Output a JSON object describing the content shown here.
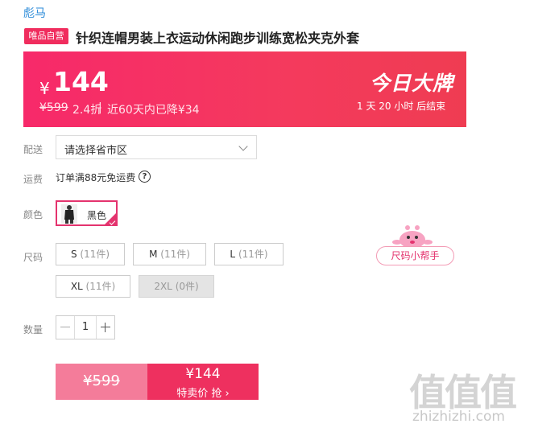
{
  "header": {
    "brand": "彪马",
    "badge": "唯品自营",
    "title": "针织连帽男装上衣运动休闲跑步训练宽松夹克外套"
  },
  "price_banner": {
    "currency": "¥",
    "price": "144",
    "original_price": "¥599",
    "discount": "2.4折",
    "separator": "|",
    "lowest_info": "近60天内已降¥34",
    "promo_title": "今日大牌",
    "countdown": "1 天 20 小时 后结束",
    "colors": {
      "start": "#f7296a",
      "end": "#ef3c52"
    }
  },
  "delivery": {
    "label": "配送",
    "select_value": "请选择省市区"
  },
  "shipping": {
    "label": "运费",
    "text": "订单满88元免运费",
    "help_icon": "question-circle-icon"
  },
  "color": {
    "label": "颜色",
    "option": "黑色",
    "selected": true
  },
  "size": {
    "label": "尺码",
    "options": [
      {
        "name": "S",
        "stock": "(11件)",
        "disabled": false
      },
      {
        "name": "M",
        "stock": "(11件)",
        "disabled": false
      },
      {
        "name": "L",
        "stock": "(11件)",
        "disabled": false
      },
      {
        "name": "XL",
        "stock": "(11件)",
        "disabled": false
      },
      {
        "name": "2XL",
        "stock": "(0件)",
        "disabled": true
      }
    ],
    "helper": "尺码小帮手"
  },
  "quantity": {
    "label": "数量",
    "value": "1"
  },
  "buy": {
    "original": "¥599",
    "price": "¥144",
    "action": "特卖价 抢 ›"
  },
  "watermark": {
    "glyphs": "值值值",
    "url": "zhizhizhi.com"
  },
  "accent_color": "#e4336e"
}
